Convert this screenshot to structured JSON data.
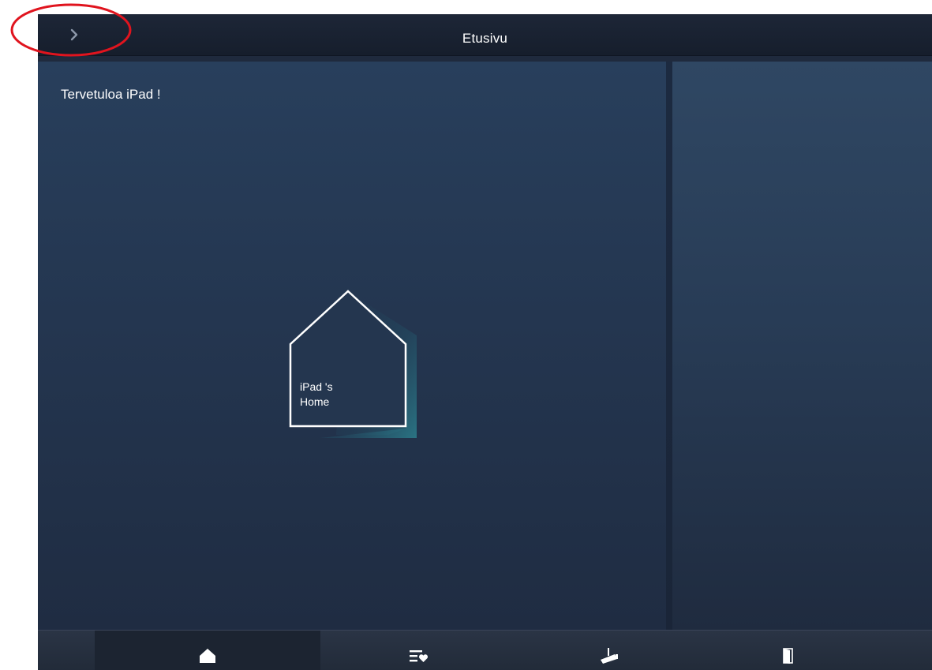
{
  "header": {
    "title": "Etusivu",
    "back_icon": "chevron-right-icon"
  },
  "main": {
    "welcome_text": "Tervetuloa iPad !",
    "home_tile": {
      "label": "iPad 's\nHome",
      "icon": "house-outline-icon"
    }
  },
  "tabbar": {
    "tabs": [
      {
        "name": "home",
        "icon": "home-icon",
        "active": true
      },
      {
        "name": "favorites",
        "icon": "favorites-list-icon",
        "active": false
      },
      {
        "name": "camera",
        "icon": "camera-icon",
        "active": false
      },
      {
        "name": "door",
        "icon": "door-icon",
        "active": false
      }
    ]
  },
  "annotation": {
    "shape": "red-ellipse",
    "color": "#e0141e"
  },
  "colors": {
    "topbar": "#1a2332",
    "main_panel": "#263a55",
    "side_panel": "#2b425d",
    "bottombar": "#262f3e",
    "tile_shadow": "#2a6a7a"
  }
}
